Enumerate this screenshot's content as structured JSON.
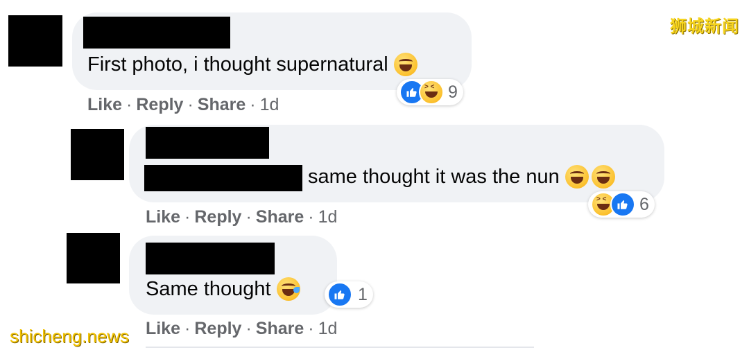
{
  "comments": [
    {
      "text": "First photo, i thought supernatural",
      "inline_emoji": [
        "laughing-tears-emoji"
      ],
      "reaction_icons": [
        "like",
        "haha"
      ],
      "reaction_count": "9",
      "actions": {
        "like": "Like",
        "reply": "Reply",
        "share": "Share",
        "time": "1d"
      }
    },
    {
      "text": "same thought it was the nun",
      "inline_emoji": [
        "laughing-tears-emoji",
        "laughing-tears-emoji"
      ],
      "reaction_icons": [
        "haha",
        "like"
      ],
      "reaction_count": "6",
      "actions": {
        "like": "Like",
        "reply": "Reply",
        "share": "Share",
        "time": "1d"
      }
    },
    {
      "text": "Same thought",
      "inline_emoji": [
        "sweat-smile-emoji"
      ],
      "reaction_icons": [
        "like"
      ],
      "reaction_count": "1",
      "actions": {
        "like": "Like",
        "reply": "Reply",
        "share": "Share",
        "time": "1d"
      }
    }
  ],
  "separator": "·",
  "watermarks": {
    "top_right": "狮城新闻",
    "bottom_left": "shicheng.news"
  },
  "colors": {
    "bubble": "#f0f2f5",
    "like_blue": "#1877f2",
    "meta_gray": "#65676b",
    "watermark": "#f2c200"
  }
}
